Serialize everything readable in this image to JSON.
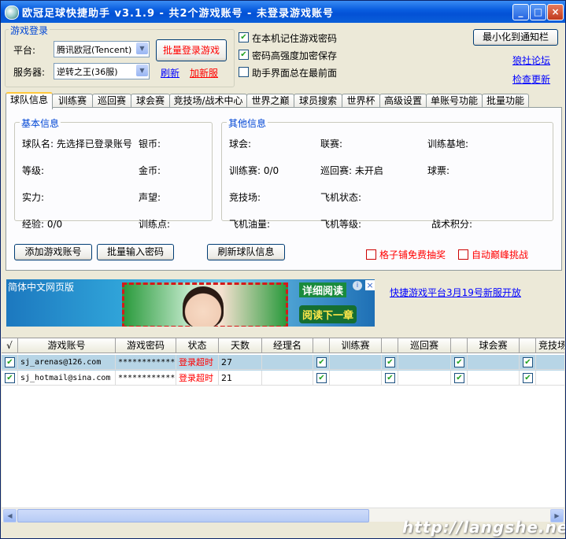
{
  "window": {
    "title": "欧冠足球快捷助手 v3.1.9 - 共2个游戏账号 - 未登录游戏账号",
    "min_glyph": "_",
    "max_glyph": "□",
    "close_glyph": "×"
  },
  "login": {
    "group_label": "游戏登录",
    "platform_label": "平台:",
    "platform_value": "腾讯欧冠(Tencent)",
    "server_label": "服务器:",
    "server_value": "逆转之王(36服)",
    "batch_login_button": "批量登录游戏",
    "refresh_link": "刷新",
    "add_server_link": "加新服"
  },
  "options": [
    {
      "label": "在本机记住游戏密码",
      "checked": true
    },
    {
      "label": "密码高强度加密保存",
      "checked": true
    },
    {
      "label": "助手界面总在最前面",
      "checked": false
    }
  ],
  "top_right": {
    "minimize_tray_button": "最小化到通知栏",
    "forum_link": "狼社论坛",
    "update_link": "检查更新"
  },
  "tabs": [
    "球队信息",
    "训练赛",
    "巡回赛",
    "球会赛",
    "竞技场/战术中心",
    "世界之巅",
    "球员搜索",
    "世界杯",
    "高级设置",
    "单账号功能",
    "批量功能"
  ],
  "active_tab": "球队信息",
  "basic_info": {
    "label": "基本信息",
    "team_name": "球队名: 先选择已登录账号",
    "coins": "银币:",
    "level": "等级:",
    "gold": "金币:",
    "strength": "实力:",
    "reputation": "声望:",
    "exp": "经验: 0/0",
    "training_points": "训练点:"
  },
  "other_info": {
    "label": "其他信息",
    "club": "球会:",
    "league": "联赛:",
    "training_base": "训练基地:",
    "training_match": "训练赛: 0/0",
    "tour": "巡回赛: 未开启",
    "tickets": "球票:",
    "arena": "竞技场:",
    "plane_status": "飞机状态:",
    "plane_fuel": "飞机油量:",
    "plane_level": "飞机等级:",
    "tactic_points": "战术积分:"
  },
  "panel_buttons": {
    "add_account": "添加游戏账号",
    "batch_import": "批量输入密码",
    "refresh_team": "刷新球队信息"
  },
  "panel_checks": [
    {
      "label": "格子铺免费抽奖",
      "checked": false
    },
    {
      "label": "自动巅峰挑战",
      "checked": false
    }
  ],
  "ad": {
    "corner_text": "简体中文网页版",
    "detail_text": "详细阅读",
    "next_text": "阅读下一章",
    "info_glyph": "i",
    "close_glyph": "×",
    "side_link": "快捷游戏平台3月19号新服开放"
  },
  "grid": {
    "columns": [
      "√",
      "游戏账号",
      "游戏密码",
      "状态",
      "天数",
      "经理名",
      "",
      "训练赛",
      "",
      "巡回赛",
      "",
      "球会赛",
      "",
      "竞技场"
    ],
    "rows": [
      {
        "checked": true,
        "account": "sj_arenas@126.com",
        "password": "************",
        "status": "登录超时",
        "days": "27",
        "manager": "",
        "c1": true,
        "c2": true,
        "c3": true,
        "c4": true
      },
      {
        "checked": true,
        "account": "sj_hotmail@sina.com",
        "password": "************",
        "status": "登录超时",
        "days": "21",
        "manager": "",
        "c1": true,
        "c2": true,
        "c3": true,
        "c4": true
      }
    ]
  },
  "watermark": "http://langshe.net",
  "colors": {
    "accent_blue": "#0046d5",
    "link": "#0000ff",
    "alert_red": "#ff0000",
    "selected_row": "#b7d5e6"
  }
}
